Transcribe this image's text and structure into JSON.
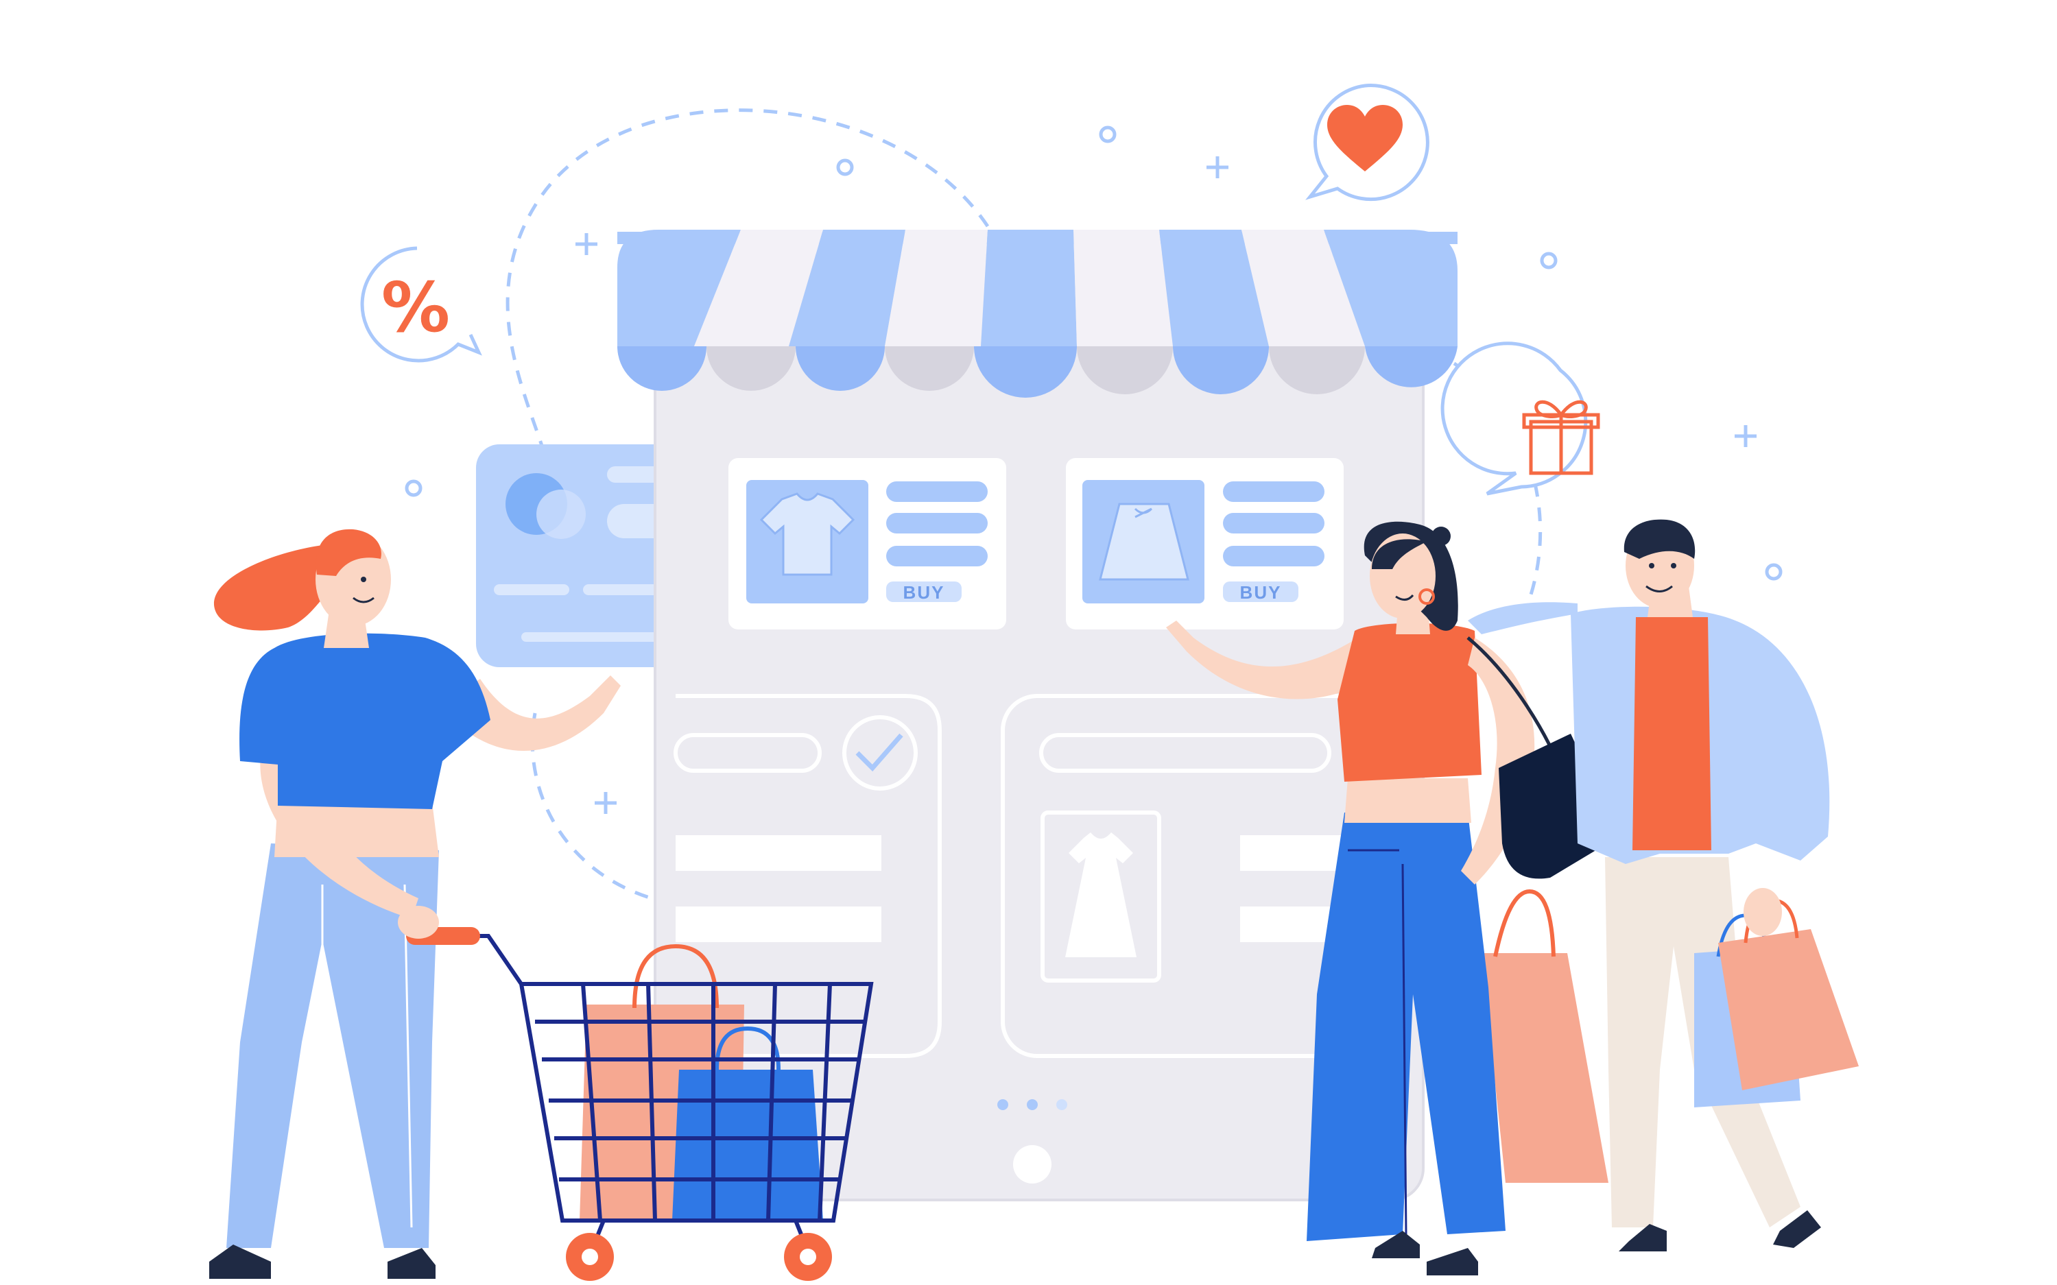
{
  "illustration": {
    "product_cards": [
      {
        "buy_label": "BUY",
        "product": "t-shirt"
      },
      {
        "buy_label": "BUY",
        "product": "skirt"
      }
    ],
    "discount_bubble": {
      "symbol": "%"
    },
    "colors": {
      "accent_blue": "#2f78e6",
      "light_blue": "#a9c8fb",
      "pale_blue": "#cfe0fd",
      "coral": "#f56a43",
      "salmon": "#f6a891",
      "phone_gray": "#ecebf1",
      "navy": "#1b2a8c",
      "skin": "#fbd6c4"
    }
  }
}
